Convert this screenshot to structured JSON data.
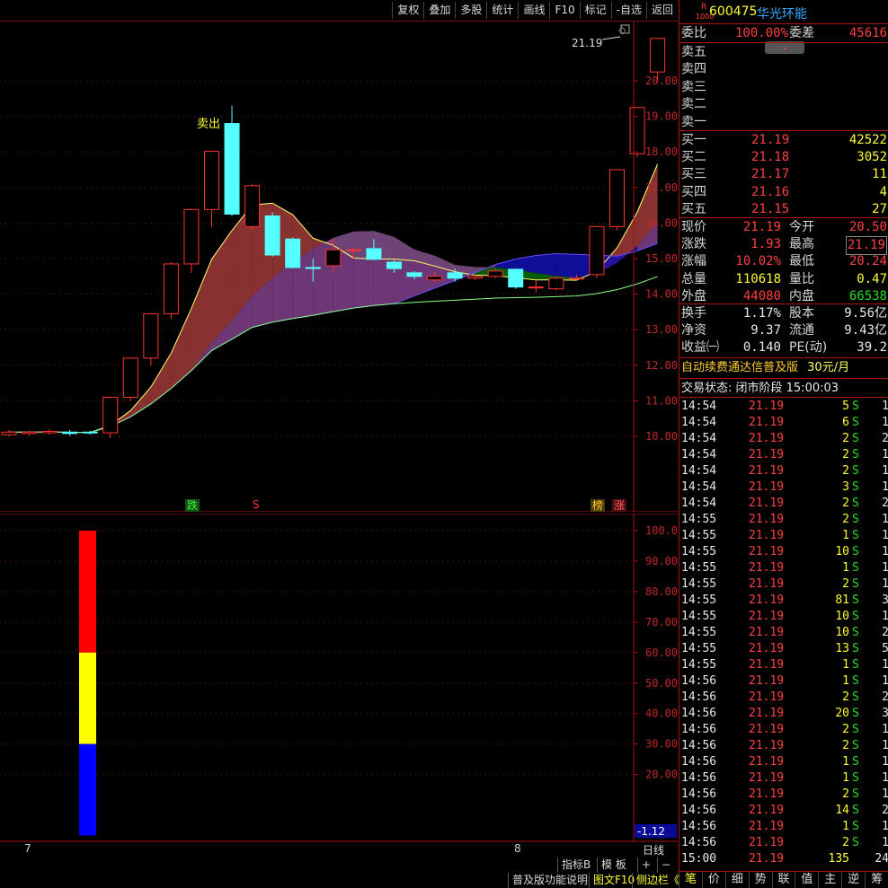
{
  "toolbar": {
    "buttons": [
      "复权",
      "叠加",
      "多股",
      "统计",
      "画线",
      "F10",
      "标记",
      "-自选",
      "返回"
    ]
  },
  "stock": {
    "badge_top": "R",
    "badge_bottom": "1000",
    "code": "600475",
    "name": "华光环能"
  },
  "chart": {
    "price_labels": [
      "20.00",
      "19.00",
      "18.00",
      "17.00",
      "16.00",
      "15.00",
      "14.00",
      "13.00",
      "12.00",
      "11.00",
      "10.00"
    ],
    "price_tag": "21.19",
    "sell_label": "卖出",
    "markers": {
      "die": "跌",
      "s": "S",
      "bang": "榜",
      "zhang": "涨"
    },
    "date_labels": [
      "7",
      "8"
    ],
    "candles": [
      {
        "o": 10.05,
        "c": 10.12,
        "h": 10.18,
        "l": 10.0
      },
      {
        "o": 10.08,
        "c": 10.12,
        "h": 10.16,
        "l": 10.02
      },
      {
        "o": 10.1,
        "c": 10.14,
        "h": 10.2,
        "l": 10.05
      },
      {
        "o": 10.12,
        "c": 10.08,
        "h": 10.18,
        "l": 10.02
      },
      {
        "o": 10.12,
        "c": 10.1,
        "h": 10.16,
        "l": 10.05
      },
      {
        "o": 10.1,
        "c": 11.1,
        "h": 11.12,
        "l": 9.95
      },
      {
        "o": 11.1,
        "c": 12.2,
        "h": 12.2,
        "l": 11.0
      },
      {
        "o": 12.2,
        "c": 13.45,
        "h": 13.47,
        "l": 12.0
      },
      {
        "o": 13.45,
        "c": 14.85,
        "h": 14.9,
        "l": 13.3
      },
      {
        "o": 14.85,
        "c": 16.38,
        "h": 16.4,
        "l": 14.6
      },
      {
        "o": 16.38,
        "c": 18.02,
        "h": 18.02,
        "l": 15.9
      },
      {
        "o": 18.8,
        "c": 16.25,
        "h": 19.3,
        "l": 16.2
      },
      {
        "o": 15.9,
        "c": 17.05,
        "h": 17.1,
        "l": 15.8
      },
      {
        "o": 16.2,
        "c": 15.1,
        "h": 16.3,
        "l": 15.05
      },
      {
        "o": 15.55,
        "c": 14.75,
        "h": 15.6,
        "l": 14.72
      },
      {
        "o": 14.75,
        "c": 14.72,
        "h": 15.0,
        "l": 14.35
      },
      {
        "o": 14.8,
        "c": 15.25,
        "h": 15.55,
        "l": 14.6
      },
      {
        "o": 15.25,
        "c": 15.25,
        "h": 15.3,
        "l": 15.0
      },
      {
        "o": 15.28,
        "c": 14.98,
        "h": 15.55,
        "l": 14.95
      },
      {
        "o": 14.9,
        "c": 14.72,
        "h": 14.95,
        "l": 14.6
      },
      {
        "o": 14.6,
        "c": 14.5,
        "h": 14.65,
        "l": 14.42
      },
      {
        "o": 14.4,
        "c": 14.5,
        "h": 14.62,
        "l": 14.35
      },
      {
        "o": 14.6,
        "c": 14.45,
        "h": 14.72,
        "l": 14.35
      },
      {
        "o": 14.45,
        "c": 14.5,
        "h": 14.55,
        "l": 14.4
      },
      {
        "o": 14.5,
        "c": 14.65,
        "h": 14.72,
        "l": 14.45
      },
      {
        "o": 14.7,
        "c": 14.2,
        "h": 14.72,
        "l": 14.15
      },
      {
        "o": 14.2,
        "c": 14.2,
        "h": 14.4,
        "l": 14.05
      },
      {
        "o": 14.15,
        "c": 14.45,
        "h": 14.5,
        "l": 14.1
      },
      {
        "o": 14.45,
        "c": 14.45,
        "h": 14.55,
        "l": 14.4
      },
      {
        "o": 14.55,
        "c": 15.9,
        "h": 15.92,
        "l": 14.45
      },
      {
        "o": 15.9,
        "c": 17.5,
        "h": 17.52,
        "l": 15.8
      },
      {
        "o": 17.95,
        "c": 19.25,
        "h": 19.27,
        "l": 17.85
      },
      {
        "o": 20.25,
        "c": 21.19,
        "h": 21.19,
        "l": 19.95
      }
    ]
  },
  "indicator": {
    "labels": [
      "100.0",
      "90.00",
      "80.00",
      "70.00",
      "60.00",
      "50.00",
      "40.00",
      "30.00",
      "20.00"
    ],
    "value_box": "-1.12",
    "bars": [
      {
        "color": "#ff0000",
        "from": 100,
        "to": 60
      },
      {
        "color": "#ffff00",
        "from": 60,
        "to": 30
      },
      {
        "color": "#0000ff",
        "from": 30,
        "to": 0
      }
    ]
  },
  "bottom": {
    "zhibiao": "指标B",
    "moban": "模 板",
    "rixian": "日线",
    "plus": "+",
    "minus": "−",
    "pujiban": "普及版功能说明",
    "tuwen": "图文F10",
    "cebianlan": "侧边栏《"
  },
  "panel": {
    "weibi_label": "委比",
    "weibi": "100.00%",
    "weicha_label": "委差",
    "weicha": "45616",
    "sells": [
      "卖五",
      "卖四",
      "卖三",
      "卖二",
      "卖一"
    ],
    "buys": [
      {
        "label": "买一",
        "price": "21.19",
        "vol": "42522"
      },
      {
        "label": "买二",
        "price": "21.18",
        "vol": "3052"
      },
      {
        "label": "买三",
        "price": "21.17",
        "vol": "11"
      },
      {
        "label": "买四",
        "price": "21.16",
        "vol": "4"
      },
      {
        "label": "买五",
        "price": "21.15",
        "vol": "27"
      }
    ],
    "stats": [
      {
        "l1": "现价",
        "v1": "21.19",
        "c1": "red",
        "l2": "今开",
        "v2": "20.50",
        "c2": "red"
      },
      {
        "l1": "涨跌",
        "v1": "1.93",
        "c1": "red",
        "l2": "最高",
        "v2": "21.19",
        "c2": "red"
      },
      {
        "l1": "涨幅",
        "v1": "10.02%",
        "c1": "red",
        "l2": "最低",
        "v2": "20.24",
        "c2": "red"
      },
      {
        "l1": "总量",
        "v1": "110618",
        "c1": "yellow",
        "l2": "量比",
        "v2": "0.47",
        "c2": "yellow"
      },
      {
        "l1": "外盘",
        "v1": "44080",
        "c1": "red",
        "l2": "内盘",
        "v2": "66538",
        "c2": "green"
      }
    ],
    "stats2": [
      {
        "l1": "换手",
        "v1": "1.17%",
        "l2": "股本",
        "v2": "9.56亿"
      },
      {
        "l1": "净资",
        "v1": "9.37",
        "l2": "流通",
        "v2": "9.43亿"
      },
      {
        "l1": "收益㈠",
        "v1": "0.140",
        "l2": "PE(动)",
        "v2": "39.2"
      }
    ],
    "promo": "自动续费通达信普及版",
    "promo_price": "30元/月",
    "trade_status": "交易状态: 闭市阶段 15:00:03",
    "ticks": [
      {
        "t": "14:54",
        "p": "21.19",
        "v": "5",
        "s": "S",
        "n": "1"
      },
      {
        "t": "14:54",
        "p": "21.19",
        "v": "6",
        "s": "S",
        "n": "1"
      },
      {
        "t": "14:54",
        "p": "21.19",
        "v": "2",
        "s": "S",
        "n": "2"
      },
      {
        "t": "14:54",
        "p": "21.19",
        "v": "2",
        "s": "S",
        "n": "1"
      },
      {
        "t": "14:54",
        "p": "21.19",
        "v": "2",
        "s": "S",
        "n": "1"
      },
      {
        "t": "14:54",
        "p": "21.19",
        "v": "3",
        "s": "S",
        "n": "1"
      },
      {
        "t": "14:54",
        "p": "21.19",
        "v": "2",
        "s": "S",
        "n": "2"
      },
      {
        "t": "14:55",
        "p": "21.19",
        "v": "2",
        "s": "S",
        "n": "1"
      },
      {
        "t": "14:55",
        "p": "21.19",
        "v": "1",
        "s": "S",
        "n": "1"
      },
      {
        "t": "14:55",
        "p": "21.19",
        "v": "10",
        "s": "S",
        "n": "1"
      },
      {
        "t": "14:55",
        "p": "21.19",
        "v": "1",
        "s": "S",
        "n": "1"
      },
      {
        "t": "14:55",
        "p": "21.19",
        "v": "2",
        "s": "S",
        "n": "1"
      },
      {
        "t": "14:55",
        "p": "21.19",
        "v": "81",
        "s": "S",
        "n": "3"
      },
      {
        "t": "14:55",
        "p": "21.19",
        "v": "10",
        "s": "S",
        "n": "1"
      },
      {
        "t": "14:55",
        "p": "21.19",
        "v": "10",
        "s": "S",
        "n": "2"
      },
      {
        "t": "14:55",
        "p": "21.19",
        "v": "13",
        "s": "S",
        "n": "5"
      },
      {
        "t": "14:55",
        "p": "21.19",
        "v": "1",
        "s": "S",
        "n": "1"
      },
      {
        "t": "14:56",
        "p": "21.19",
        "v": "1",
        "s": "S",
        "n": "1"
      },
      {
        "t": "14:56",
        "p": "21.19",
        "v": "2",
        "s": "S",
        "n": "2"
      },
      {
        "t": "14:56",
        "p": "21.19",
        "v": "20",
        "s": "S",
        "n": "3"
      },
      {
        "t": "14:56",
        "p": "21.19",
        "v": "2",
        "s": "S",
        "n": "1"
      },
      {
        "t": "14:56",
        "p": "21.19",
        "v": "2",
        "s": "S",
        "n": "1"
      },
      {
        "t": "14:56",
        "p": "21.19",
        "v": "1",
        "s": "S",
        "n": "1"
      },
      {
        "t": "14:56",
        "p": "21.19",
        "v": "1",
        "s": "S",
        "n": "1"
      },
      {
        "t": "14:56",
        "p": "21.19",
        "v": "2",
        "s": "S",
        "n": "1"
      },
      {
        "t": "14:56",
        "p": "21.19",
        "v": "14",
        "s": "S",
        "n": "2"
      },
      {
        "t": "14:56",
        "p": "21.19",
        "v": "1",
        "s": "S",
        "n": "1"
      },
      {
        "t": "14:56",
        "p": "21.19",
        "v": "2",
        "s": "S",
        "n": "1"
      },
      {
        "t": "15:00",
        "p": "21.19",
        "v": "135",
        "s": "",
        "n": "24"
      }
    ],
    "tabs": [
      "笔",
      "价",
      "细",
      "势",
      "联",
      "值",
      "主",
      "逆",
      "筹"
    ]
  }
}
